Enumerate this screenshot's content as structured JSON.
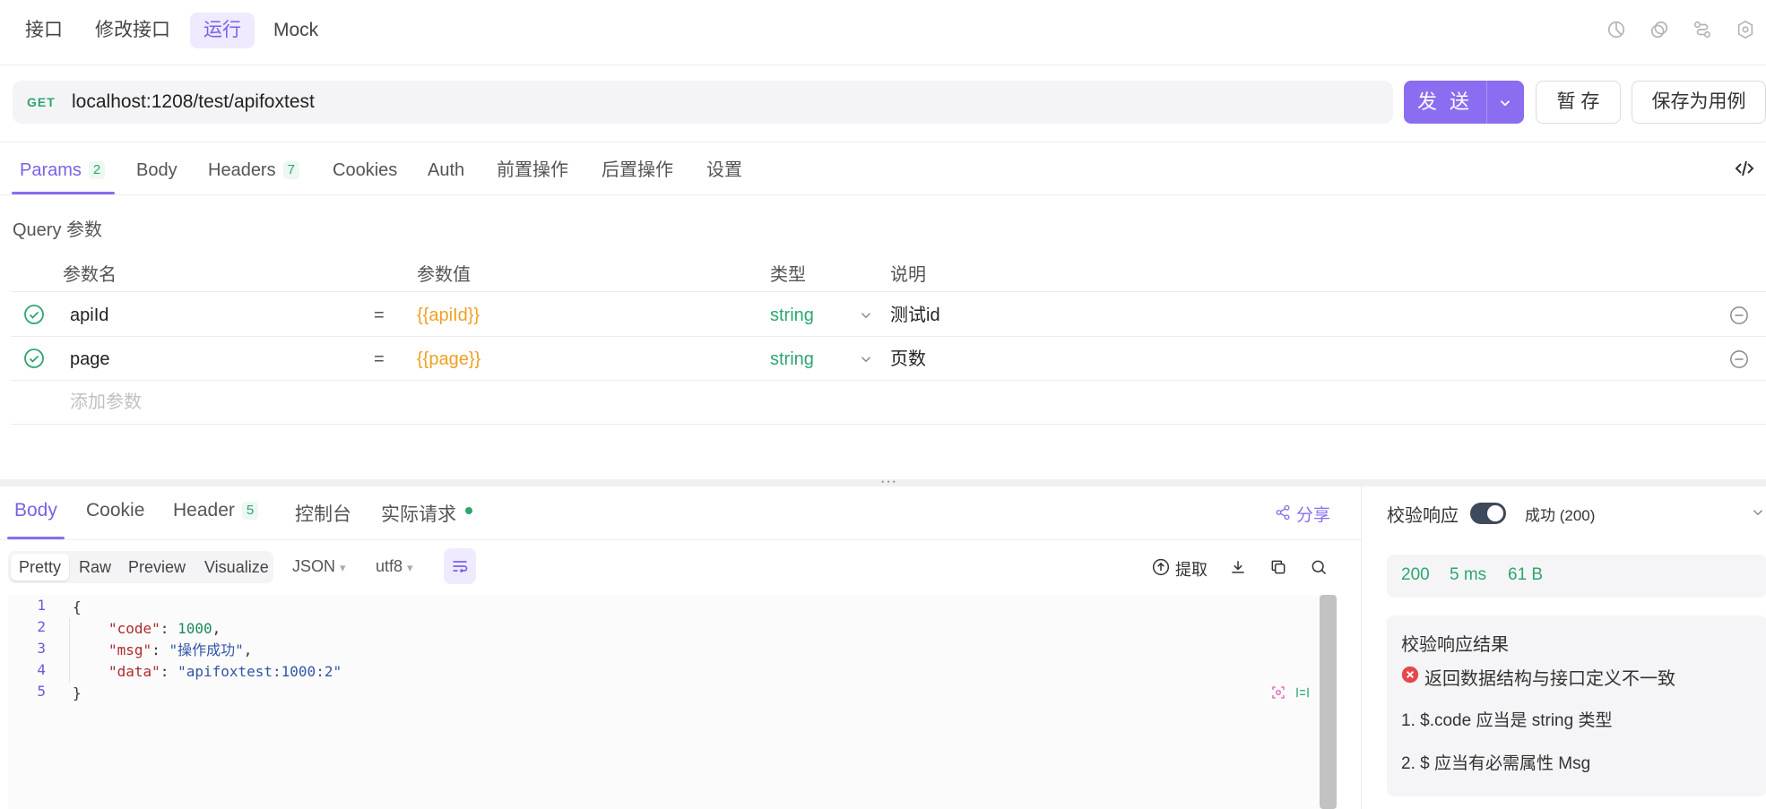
{
  "top_tabs": [
    {
      "label": "接口",
      "active": false
    },
    {
      "label": "修改接口",
      "active": false
    },
    {
      "label": "运行",
      "active": true
    },
    {
      "label": "Mock",
      "active": false
    }
  ],
  "top_icons": [
    "chart-pie-icon",
    "copy-icon",
    "branch-icon",
    "settings-icon"
  ],
  "request": {
    "method": "GET",
    "url": "localhost:1208/test/apifoxtest",
    "send_label": "发 送",
    "save_label": "暂 存",
    "save_example_label": "保存为用例"
  },
  "request_tabs": [
    {
      "label": "Params",
      "badge": "2",
      "active": true
    },
    {
      "label": "Body",
      "badge": "",
      "active": false
    },
    {
      "label": "Headers",
      "badge": "7",
      "active": false
    },
    {
      "label": "Cookies",
      "badge": "",
      "active": false
    },
    {
      "label": "Auth",
      "badge": "",
      "active": false
    },
    {
      "label": "前置操作",
      "badge": "",
      "active": false
    },
    {
      "label": "后置操作",
      "badge": "",
      "active": false
    },
    {
      "label": "设置",
      "badge": "",
      "active": false
    }
  ],
  "query": {
    "title": "Query 参数",
    "columns": [
      "参数名",
      "参数值",
      "类型",
      "说明"
    ],
    "rows": [
      {
        "name": "apiId",
        "eq": "=",
        "value": "{{apiId}}",
        "type": "string",
        "desc": "测试id"
      },
      {
        "name": "page",
        "eq": "=",
        "value": "{{page}}",
        "type": "string",
        "desc": "页数"
      }
    ],
    "add_placeholder": "添加参数"
  },
  "response_tabs": [
    {
      "label": "Body",
      "badge": "",
      "active": true
    },
    {
      "label": "Cookie",
      "badge": "",
      "active": false
    },
    {
      "label": "Header",
      "badge": "5",
      "active": false
    },
    {
      "label": "控制台",
      "badge": "",
      "active": false
    },
    {
      "label": "实际请求",
      "badge": "",
      "active": false
    }
  ],
  "share_label": "分享",
  "view_modes": [
    "Pretty",
    "Raw",
    "Preview",
    "Visualize"
  ],
  "format": "JSON",
  "encoding": "utf8",
  "extract_label": "提取",
  "code": {
    "line_numbers": [
      "1",
      "2",
      "3",
      "4",
      "5"
    ],
    "open_brace": "{",
    "close_brace": "}",
    "fields": [
      {
        "key": "\"code\"",
        "value": "1000",
        "kind": "num"
      },
      {
        "key": "\"msg\"",
        "value": "\"操作成功\"",
        "kind": "str"
      },
      {
        "key": "\"data\"",
        "value": "\"apifoxtest:1000:2\"",
        "kind": "str"
      }
    ]
  },
  "validation": {
    "label": "校验响应",
    "toggle_on": true,
    "status": "成功 (200)",
    "status_code": "200",
    "time": "5 ms",
    "size": "61 B",
    "result_title": "校验响应结果",
    "error": "返回数据结构与接口定义不一致",
    "details": [
      "1. $.code 应当是 string 类型",
      "2. $ 应当有必需属性 Msg"
    ]
  },
  "colors": {
    "accent": "#8a6df0",
    "success": "#2da66f",
    "variable": "#f0a020",
    "error": "#e5484d"
  }
}
